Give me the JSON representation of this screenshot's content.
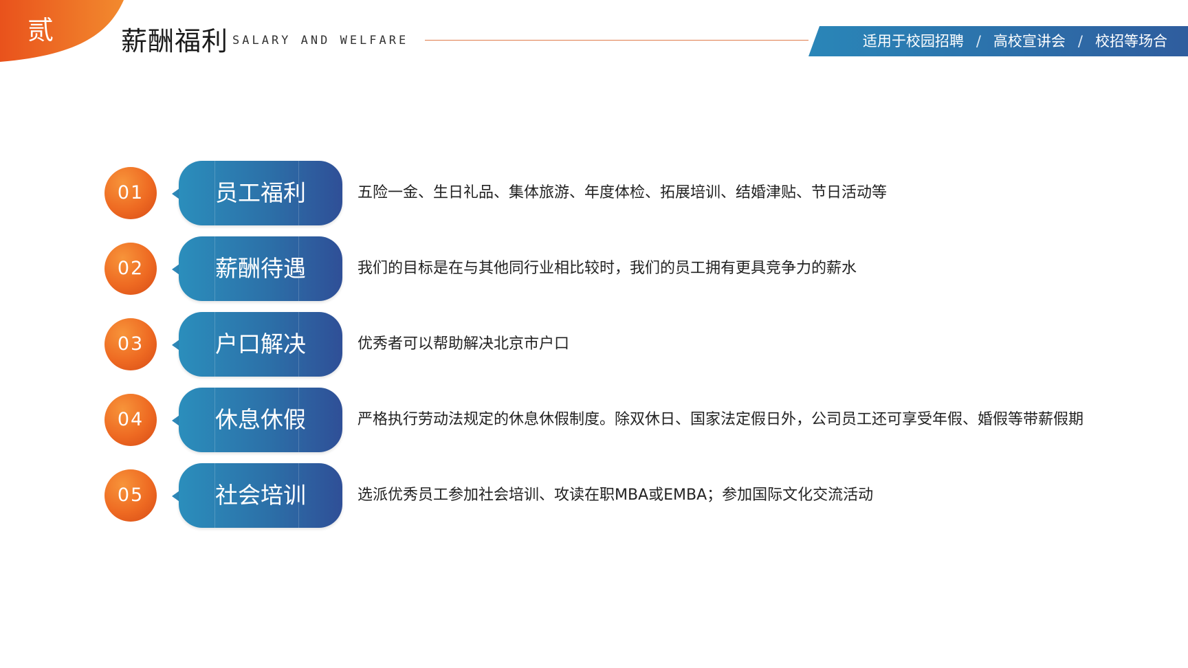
{
  "header": {
    "corner_label": "贰",
    "title": "薪酬福利",
    "subtitle": "SALARY AND WELFARE",
    "banner": {
      "items": [
        "适用于校园招聘",
        "高校宣讲会",
        "校招等场合"
      ],
      "separator": "/"
    }
  },
  "items": [
    {
      "number": "01",
      "title": "员工福利",
      "description": "五险一金、生日礼品、集体旅游、年度体检、拓展培训、结婚津贴、节日活动等"
    },
    {
      "number": "02",
      "title": "薪酬待遇",
      "description": "我们的目标是在与其他同行业相比较时，我们的员工拥有更具竞争力的薪水"
    },
    {
      "number": "03",
      "title": "户口解决",
      "description": "优秀者可以帮助解决北京市户口"
    },
    {
      "number": "04",
      "title": "休息休假",
      "description": "严格执行劳动法规定的休息休假制度。除双休日、国家法定假日外，公司员工还可享受年假、婚假等带薪假期"
    },
    {
      "number": "05",
      "title": "社会培训",
      "description": "选派优秀员工参加社会培训、攻读在职MBA或EMBA；参加国际文化交流活动"
    }
  ],
  "colors": {
    "accent_orange": "#ee6a22",
    "accent_blue": "#2c70a8"
  }
}
